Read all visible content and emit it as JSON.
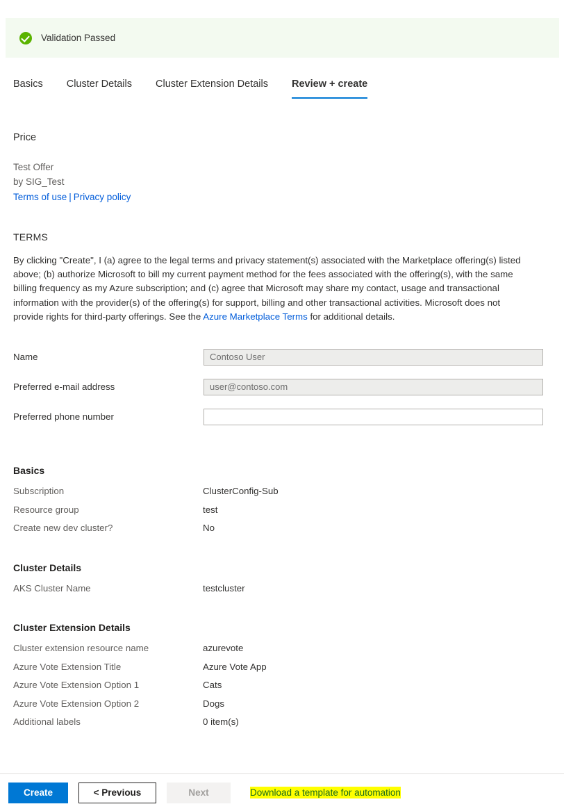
{
  "banner": {
    "icon": "check-circle-icon",
    "text": "Validation Passed",
    "background_color": "#f3faf0",
    "icon_color": "#5ab300"
  },
  "tabs": [
    {
      "label": "Basics",
      "active": false
    },
    {
      "label": "Cluster Details",
      "active": false
    },
    {
      "label": "Cluster Extension Details",
      "active": false
    },
    {
      "label": "Review + create",
      "active": true
    }
  ],
  "price": {
    "heading": "Price",
    "offer_name": "Test Offer",
    "publisher": "by SIG_Test",
    "terms_of_use_link": "Terms of use",
    "separator": "|",
    "privacy_policy_link": "Privacy policy"
  },
  "terms": {
    "heading": "TERMS",
    "paragraph_part1": "By clicking \"Create\", I (a) agree to the legal terms and privacy statement(s) associated with the Marketplace offering(s) listed above; (b) authorize Microsoft to bill my current payment method for the fees associated with the offering(s), with the same billing frequency as my Azure subscription; and (c) agree that Microsoft may share my contact, usage and transactional information with the provider(s) of the offering(s) for support, billing and other transactional activities. Microsoft does not provide rights for third-party offerings. See the ",
    "inline_link": "Azure Marketplace Terms",
    "paragraph_part2": " for additional details."
  },
  "form": {
    "fields": [
      {
        "label": "Name",
        "value": "Contoso User",
        "placeholder": "",
        "readonly": true
      },
      {
        "label": "Preferred e-mail address",
        "value": "user@contoso.com",
        "placeholder": "",
        "readonly": true
      },
      {
        "label": "Preferred phone number",
        "value": "",
        "placeholder": "",
        "readonly": false
      }
    ]
  },
  "summary_sections": [
    {
      "title": "Basics",
      "rows": [
        {
          "key": "Subscription",
          "value": "ClusterConfig-Sub"
        },
        {
          "key": "Resource group",
          "value": "test"
        },
        {
          "key": "Create new dev cluster?",
          "value": "No"
        }
      ]
    },
    {
      "title": "Cluster Details",
      "rows": [
        {
          "key": "AKS Cluster Name",
          "value": "testcluster"
        }
      ]
    },
    {
      "title": "Cluster Extension Details",
      "rows": [
        {
          "key": "Cluster extension resource name",
          "value": "azurevote"
        },
        {
          "key": "Azure Vote Extension Title",
          "value": "Azure Vote App"
        },
        {
          "key": "Azure Vote Extension Option 1",
          "value": "Cats"
        },
        {
          "key": "Azure Vote Extension Option 2",
          "value": "Dogs"
        },
        {
          "key": "Additional labels",
          "value": "0 item(s)"
        }
      ]
    }
  ],
  "footer": {
    "create_label": "Create",
    "previous_label": "< Previous",
    "next_label": "Next",
    "download_link_label": "Download a template for automation",
    "primary_color": "#0078d4",
    "highlight_color": "#ffff00"
  }
}
